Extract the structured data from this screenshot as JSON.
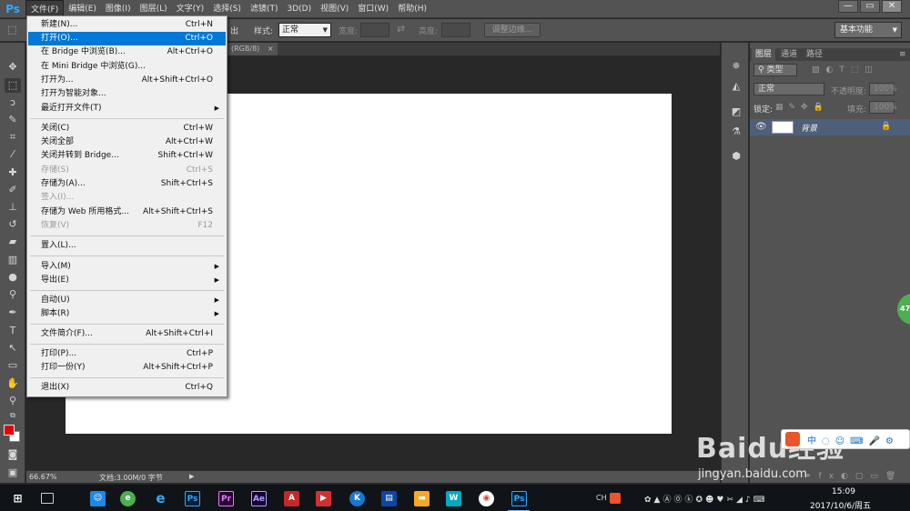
{
  "app": {
    "logo": "Ps"
  },
  "menubar": {
    "items": [
      "文件(F)",
      "编辑(E)",
      "图像(I)",
      "图层(L)",
      "文字(Y)",
      "选择(S)",
      "滤镜(T)",
      "3D(D)",
      "视图(V)",
      "窗口(W)",
      "帮助(H)"
    ],
    "active_index": 0
  },
  "window_controls": {
    "minimize": "—",
    "restore": "▭",
    "close": "✕"
  },
  "options_bar": {
    "style_label": "样式:",
    "style_value": "正常",
    "width_label": "宽度:",
    "height_label": "高度:",
    "refine_edge_label": "调整边缘...",
    "workspace_value": "基本功能",
    "partial_label": "出"
  },
  "document": {
    "tab_title": "(RGB/8)"
  },
  "status": {
    "zoom": "66.67%",
    "doc_info": "文档:3.00M/0 字节"
  },
  "layers_panel": {
    "tabs": [
      "图层",
      "通道",
      "路径"
    ],
    "active_tab": 0,
    "filter_kind": "类型",
    "blend_mode": "正常",
    "opacity_label": "不透明度:",
    "opacity_value": "100%",
    "lock_label": "锁定:",
    "fill_label": "填充:",
    "fill_value": "100%",
    "layer_name": "背景"
  },
  "file_menu": {
    "items": [
      {
        "label": "新建(N)...",
        "shortcut": "Ctrl+N"
      },
      {
        "label": "打开(O)...",
        "shortcut": "Ctrl+O",
        "highlighted": true
      },
      {
        "label": "在 Bridge 中浏览(B)...",
        "shortcut": "Alt+Ctrl+O"
      },
      {
        "label": "在 Mini Bridge 中浏览(G)...",
        "shortcut": ""
      },
      {
        "label": "打开为...",
        "shortcut": "Alt+Shift+Ctrl+O"
      },
      {
        "label": "打开为智能对象...",
        "shortcut": ""
      },
      {
        "label": "最近打开文件(T)",
        "shortcut": "",
        "submenu": true
      },
      {
        "label": "关闭(C)",
        "shortcut": "Ctrl+W"
      },
      {
        "label": "关闭全部",
        "shortcut": "Alt+Ctrl+W"
      },
      {
        "label": "关闭并转到 Bridge...",
        "shortcut": "Shift+Ctrl+W"
      },
      {
        "label": "存储(S)",
        "shortcut": "Ctrl+S",
        "disabled": true
      },
      {
        "label": "存储为(A)...",
        "shortcut": "Shift+Ctrl+S"
      },
      {
        "label": "签入(I)...",
        "shortcut": "",
        "disabled": true
      },
      {
        "label": "存储为 Web 所用格式...",
        "shortcut": "Alt+Shift+Ctrl+S"
      },
      {
        "label": "恢复(V)",
        "shortcut": "F12",
        "disabled": true
      },
      {
        "label": "置入(L)...",
        "shortcut": ""
      },
      {
        "label": "导入(M)",
        "shortcut": "",
        "submenu": true
      },
      {
        "label": "导出(E)",
        "shortcut": "",
        "submenu": true
      },
      {
        "label": "自动(U)",
        "shortcut": "",
        "submenu": true
      },
      {
        "label": "脚本(R)",
        "shortcut": "",
        "submenu": true
      },
      {
        "label": "文件简介(F)...",
        "shortcut": "Alt+Shift+Ctrl+I"
      },
      {
        "label": "打印(P)...",
        "shortcut": "Ctrl+P"
      },
      {
        "label": "打印一份(Y)",
        "shortcut": "Alt+Shift+Ctrl+P"
      },
      {
        "label": "退出(X)",
        "shortcut": "Ctrl+Q"
      }
    ]
  },
  "taskbar": {
    "tray_lang": "CH",
    "time": "15:09",
    "date": "2017/10/6/周五"
  },
  "watermark": {
    "brand": "Baidu经验",
    "url": "jingyan.baidu.com"
  },
  "badge": {
    "text": "47"
  },
  "colors": {
    "foreground": "#e40000",
    "background": "#ffffff",
    "accent": "#0078d7",
    "ps_blue": "#31a8ff"
  }
}
